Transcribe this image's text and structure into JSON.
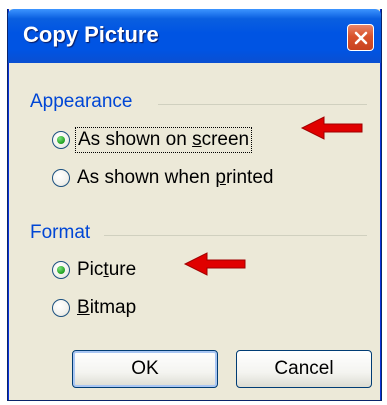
{
  "dialog": {
    "title": "Copy Picture",
    "close_icon": "close-icon"
  },
  "appearance": {
    "label": "Appearance",
    "options": [
      {
        "pre": "As shown on ",
        "accel": "s",
        "post": "creen",
        "selected": true
      },
      {
        "pre": "As shown when ",
        "accel": "p",
        "post": "rinted",
        "selected": false
      }
    ]
  },
  "format": {
    "label": "Format",
    "options": [
      {
        "pre": "Pic",
        "accel": "t",
        "post": "ure",
        "selected": true
      },
      {
        "pre": "",
        "accel": "B",
        "post": "itmap",
        "selected": false
      }
    ]
  },
  "buttons": {
    "ok": "OK",
    "cancel": "Cancel"
  },
  "colors": {
    "annotation_arrow": "#e00000",
    "titlebar": "#0054e3",
    "group_label": "#0046d5"
  }
}
